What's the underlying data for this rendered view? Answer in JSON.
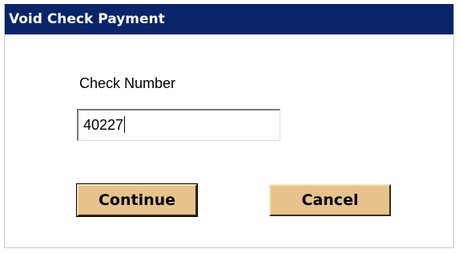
{
  "dialog": {
    "title": "Void Check Payment",
    "field_label": "Check Number",
    "check_number_value": "40227",
    "continue_label": "Continue",
    "cancel_label": "Cancel"
  },
  "colors": {
    "titlebar_bg": "#0a246a",
    "button_bg": "#e6c38b"
  }
}
